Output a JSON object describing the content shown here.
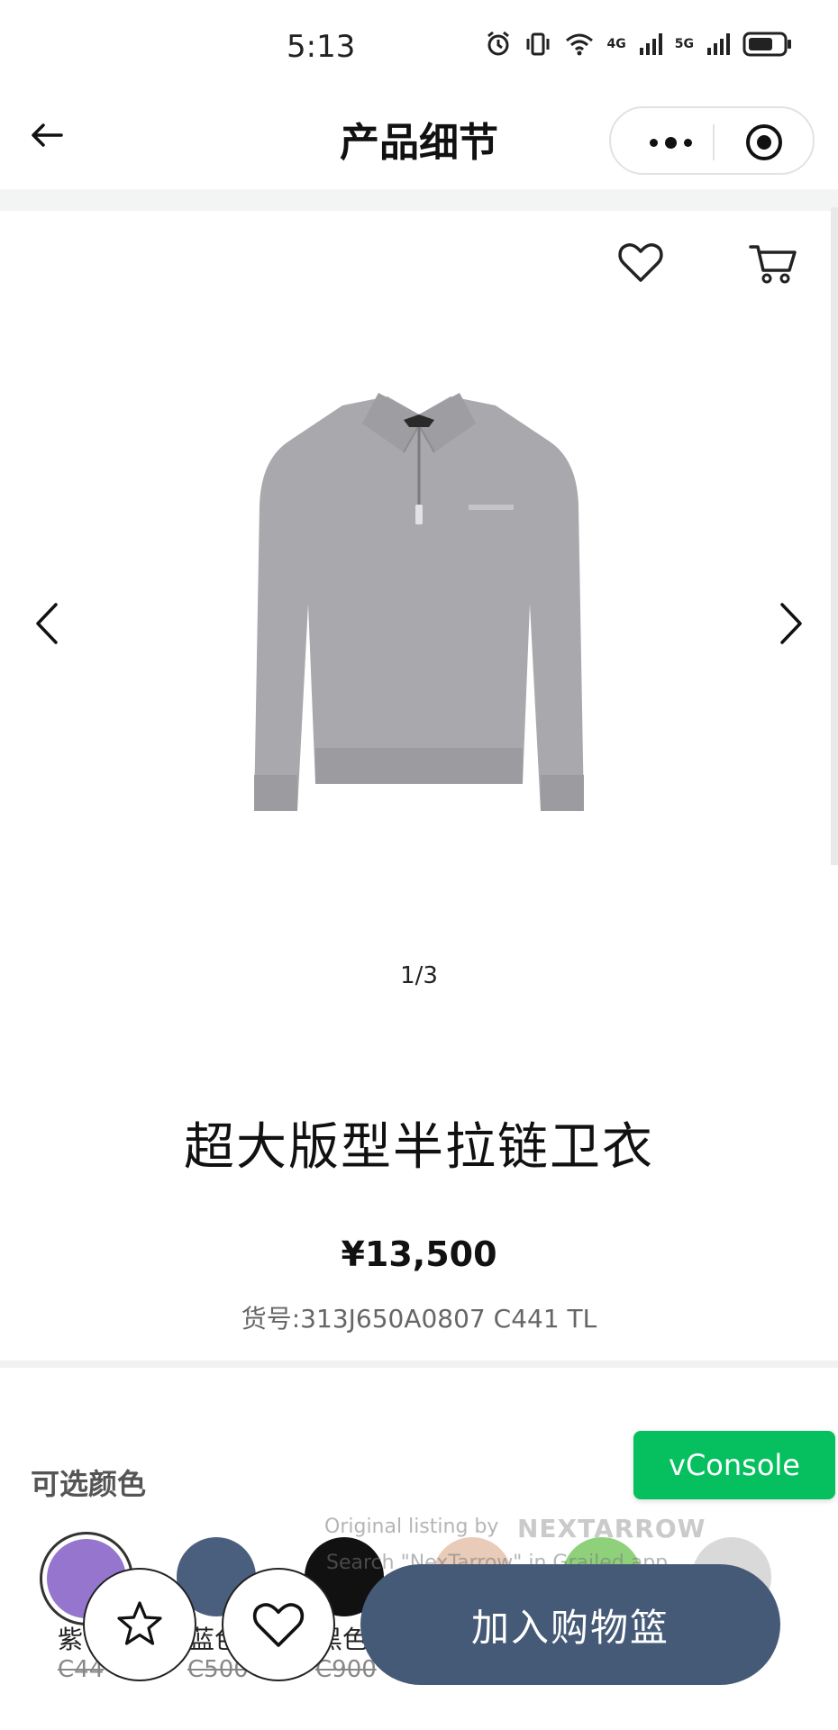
{
  "status_bar": {
    "time": "5:13",
    "network_1": "4G",
    "network_2": "5G"
  },
  "nav": {
    "title": "产品细节"
  },
  "product": {
    "pager": "1/3",
    "title": "超大版型半拉链卫衣",
    "price": "¥13,500",
    "sku": "货号:313J650A0807 C441 TL"
  },
  "colors": {
    "label": "可选颜色",
    "swatches": [
      {
        "name": "紫",
        "code": "C44",
        "hex": "#9575cd"
      },
      {
        "name": "蓝色",
        "code": "C500",
        "hex": "#4a5f7e"
      },
      {
        "name": "黑色",
        "code": "C900",
        "hex": "#111111"
      }
    ]
  },
  "overlay": {
    "vconsole": "vConsole",
    "watermark_line1": "Original listing by",
    "watermark_brand": "NEXTARROW",
    "watermark_line2": "Search \"NexTarrow\" in Grailed app."
  },
  "actions": {
    "add_to_cart": "加入购物篮"
  },
  "colors_theme": {
    "accent": "#455a77",
    "vconsole_green": "#06c05f"
  }
}
